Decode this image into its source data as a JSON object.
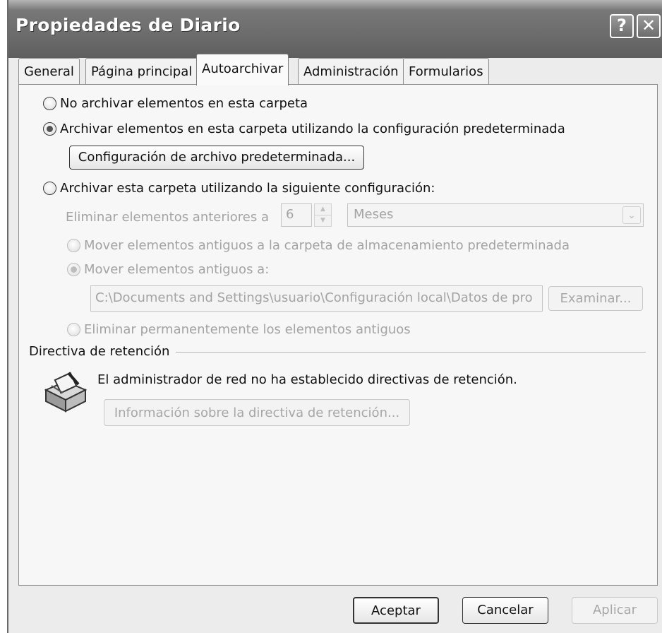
{
  "window": {
    "title": "Propiedades de Diario",
    "help_glyph": "?",
    "close_glyph": "✕"
  },
  "tabs": [
    {
      "label": "General",
      "active": false
    },
    {
      "label": "Página principal",
      "active": false
    },
    {
      "label": "Autoarchivar",
      "active": true
    },
    {
      "label": "Administración",
      "active": false
    },
    {
      "label": "Formularios",
      "active": false
    }
  ],
  "autoarchive": {
    "option_no_archive": "No archivar elementos en esta carpeta",
    "option_default": "Archivar elementos en esta carpeta utilizando la configuración predeterminada",
    "default_settings_button": "Configuración de archivo predeterminada...",
    "option_custom": "Archivar esta carpeta utilizando la siguiente configuración:",
    "selected_option": "option_default",
    "delete_older_label": "Eliminar elementos anteriores a",
    "age_value": "6",
    "age_unit": "Meses",
    "move_default_folder": "Mover elementos antiguos a la carpeta de almacenamiento predeterminada",
    "move_to_label": "Mover elementos antiguos a:",
    "move_path": "C:\\Documents and Settings\\usuario\\Configuración local\\Datos de pro",
    "browse_button": "Examinar...",
    "delete_permanently": "Eliminar permanentemente los elementos antiguos"
  },
  "retention": {
    "section_title": "Directiva de retención",
    "message": "El administrador de red no ha establecido directivas de retención.",
    "info_button": "Información sobre la directiva de retención...",
    "icon": "retention-policy-icon"
  },
  "footer": {
    "ok": "Aceptar",
    "cancel": "Cancelar",
    "apply": "Aplicar"
  }
}
